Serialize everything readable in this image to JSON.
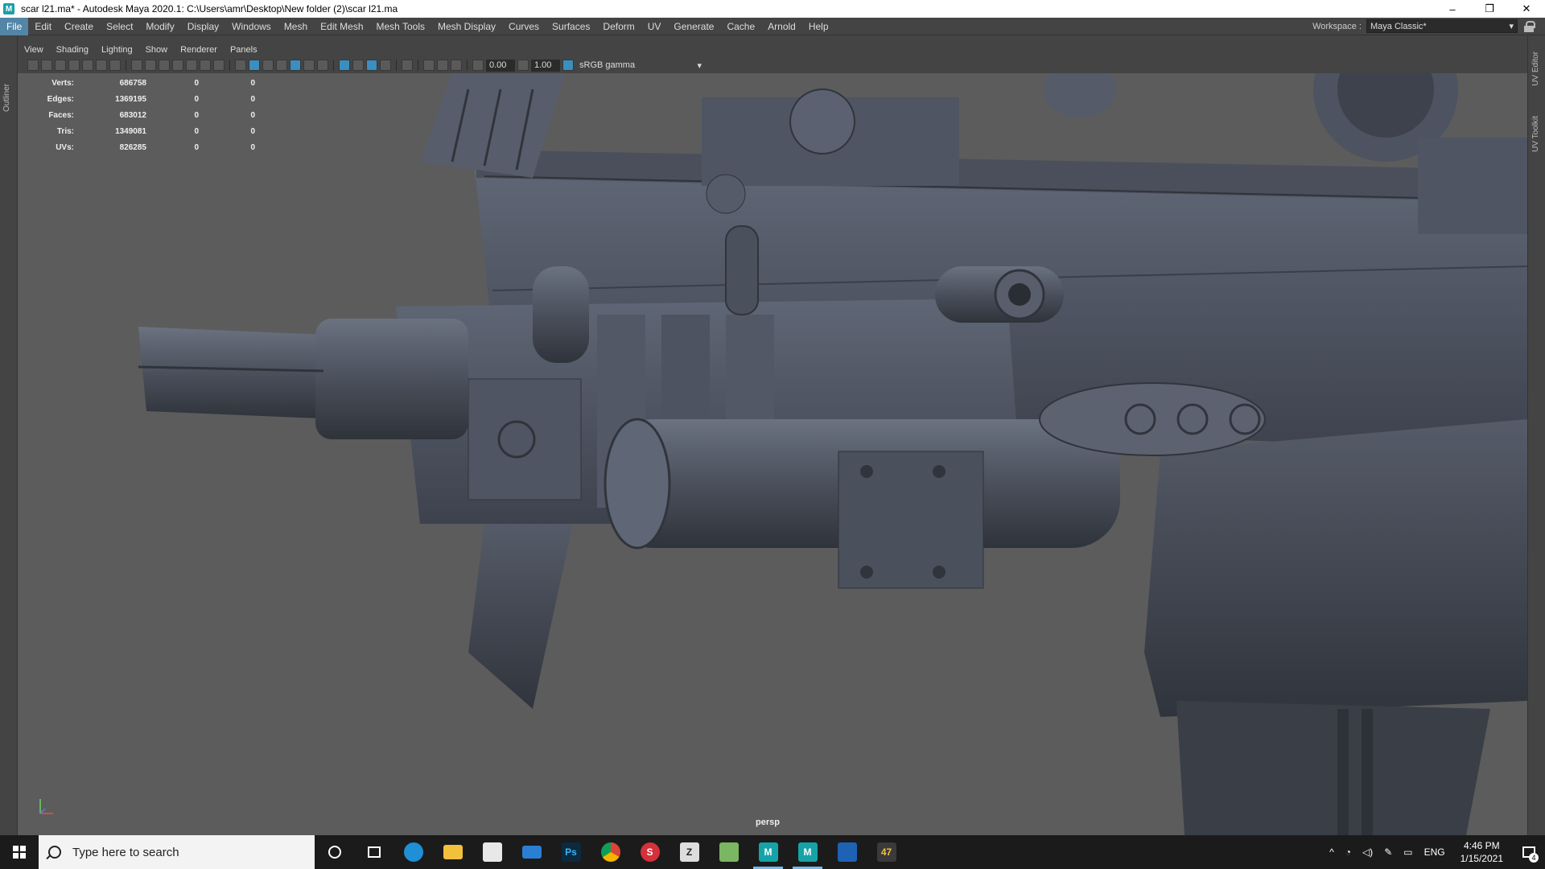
{
  "window": {
    "title": "scar l21.ma* - Autodesk Maya 2020.1: C:\\Users\\amr\\Desktop\\New folder (2)\\scar l21.ma",
    "app_icon": "M",
    "minimize": "–",
    "restore": "❐",
    "close": "✕"
  },
  "menubar": {
    "items": [
      "File",
      "Edit",
      "Create",
      "Select",
      "Modify",
      "Display",
      "Windows",
      "Mesh",
      "Edit Mesh",
      "Mesh Tools",
      "Mesh Display",
      "Curves",
      "Surfaces",
      "Deform",
      "UV",
      "Generate",
      "Cache",
      "Arnold",
      "Help"
    ],
    "active_index": 0,
    "workspace_label": "Workspace :",
    "workspace_value": "Maya Classic*"
  },
  "side_tabs": {
    "left": "Outliner",
    "right_top": "UV Editor",
    "right_bottom": "UV Toolkit"
  },
  "panel_menu": [
    "View",
    "Shading",
    "Lighting",
    "Show",
    "Renderer",
    "Panels"
  ],
  "panel_toolbar": {
    "exposure": "0.00",
    "gamma": "1.00",
    "colorspace": "sRGB gamma"
  },
  "hud": {
    "rows": [
      {
        "label": "Verts:",
        "v1": "686758",
        "v2": "0",
        "v3": "0"
      },
      {
        "label": "Edges:",
        "v1": "1369195",
        "v2": "0",
        "v3": "0"
      },
      {
        "label": "Faces:",
        "v1": "683012",
        "v2": "0",
        "v3": "0"
      },
      {
        "label": "Tris:",
        "v1": "1349081",
        "v2": "0",
        "v3": "0"
      },
      {
        "label": "UVs:",
        "v1": "826285",
        "v2": "0",
        "v3": "0"
      }
    ]
  },
  "viewport": {
    "camera_label": "persp"
  },
  "taskbar": {
    "search_placeholder": "Type here to search",
    "apps": [
      "cortana-icon",
      "task-view-icon",
      "edge-icon",
      "file-explorer-icon",
      "store-icon",
      "mail-icon",
      "photoshop-icon",
      "chrome-icon",
      "substance-icon",
      "zbrush-icon",
      "minecraft-icon",
      "maya-icon",
      "maya-icon",
      "photos-icon",
      "hitman-icon"
    ],
    "photoshop_label": "Ps",
    "substance_label": "S",
    "maya_label": "M",
    "hitman_label": "47",
    "language": "ENG",
    "time": "4:46 PM",
    "date": "1/15/2021",
    "notification_count": "4"
  }
}
